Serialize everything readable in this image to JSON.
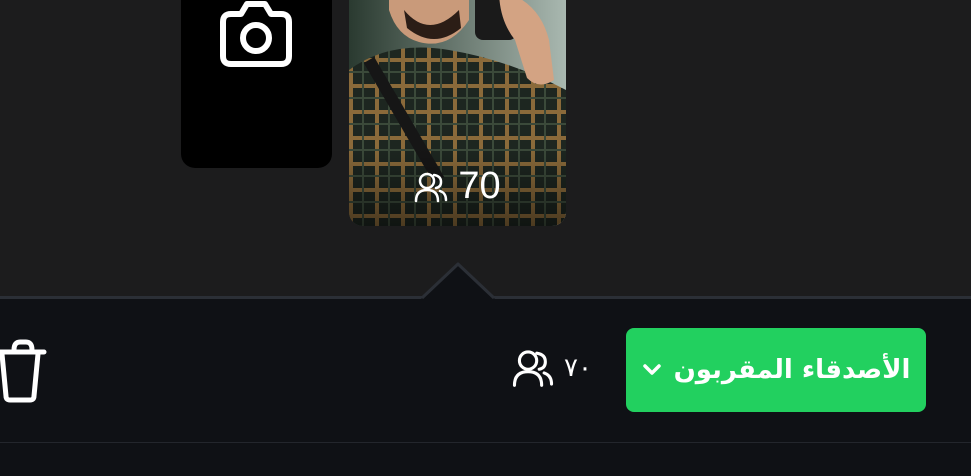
{
  "story": {
    "view_count": "70"
  },
  "footer": {
    "viewers_count": "٧٠",
    "audience_label": "الأصدقاء المقربون"
  },
  "icons": {
    "camera": "camera-icon",
    "viewers": "people-icon",
    "dropdown": "chevron-down-icon",
    "delete": "trash-icon"
  },
  "colors": {
    "background": "#1c1c1d",
    "bar": "#0f1115",
    "accent": "#22d05f",
    "tile": "#000000",
    "text": "#ffffff"
  }
}
